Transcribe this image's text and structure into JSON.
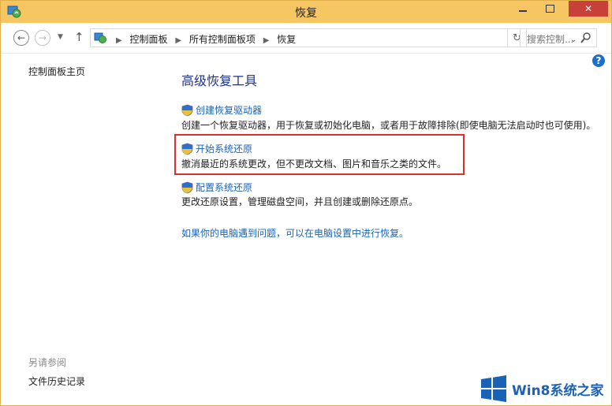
{
  "window": {
    "title": "恢复",
    "colors": {
      "titlebar": "#f5c661",
      "close": "#c7413a",
      "link": "#1a62b8",
      "heading": "#1e3287",
      "highlight": "#d9302f"
    }
  },
  "navigation": {
    "back_icon": "←",
    "forward_icon": "→",
    "recent_icon": "▼",
    "up_icon": "↑",
    "breadcrumbs": [
      "控制面板",
      "所有控制面板项",
      "恢复"
    ],
    "breadcrumb_sep": "▶",
    "dropdown_icon": "⌄",
    "refresh_icon": "↻",
    "search_placeholder": "搜索控制..."
  },
  "help_label": "?",
  "sidebar": {
    "home_link": "控制面板主页",
    "see_also_label": "另请参阅",
    "history_link": "文件历史记录"
  },
  "main": {
    "title": "高级恢复工具",
    "items": [
      {
        "label": "创建恢复驱动器",
        "description": "创建一个恢复驱动器，用于恢复或初始化电脑，或者用于故障排除(即使电脑无法启动时也可使用)。"
      },
      {
        "label": "开始系统还原",
        "description": "撤消最近的系统更改，但不更改文档、图片和音乐之类的文件。"
      },
      {
        "label": "配置系统还原",
        "description": "更改还原设置，管理磁盘空间，并且创建或删除还原点。"
      }
    ],
    "bottom_link": "如果你的电脑遇到问题，可以在电脑设置中进行恢复。"
  },
  "watermark": {
    "text": "Win8系统之家"
  }
}
